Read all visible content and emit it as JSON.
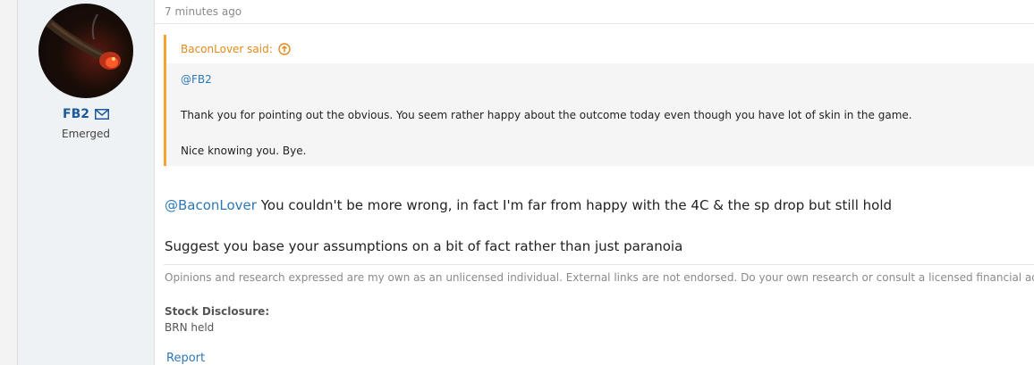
{
  "user": {
    "name": "FB2",
    "title": "Emerged"
  },
  "post": {
    "date": "7 minutes ago",
    "quote": {
      "author_label": "BaconLover said:",
      "mention": "@FB2",
      "line1": "Thank you for pointing out the obvious. You seem rather happy about the outcome today even though you have lot of skin in the game.",
      "line2": "Nice knowing you. Bye."
    },
    "reply": {
      "mention": "@BaconLover",
      "line1_rest": " You couldn't be more wrong, in fact I'm far from happy with the 4C & the sp drop but still hold",
      "line2": "Suggest you base your assumptions on a bit of fact rather than just paranoia"
    },
    "signature": {
      "disclaimer": "Opinions and research expressed are my own as an unlicensed individual. External links are not endorsed. Do your own research or consult a licensed financial advisor.",
      "stock_label": "Stock Disclosure:",
      "stock_value": "BRN held"
    },
    "actions": {
      "report": "Report"
    }
  },
  "colors": {
    "link": "#2c77b6",
    "quote_accent": "#f6a430",
    "username": "#1e5a99"
  },
  "icons": {
    "mail": "envelope-icon",
    "quote_jump": "arrow-up-circle-icon"
  }
}
